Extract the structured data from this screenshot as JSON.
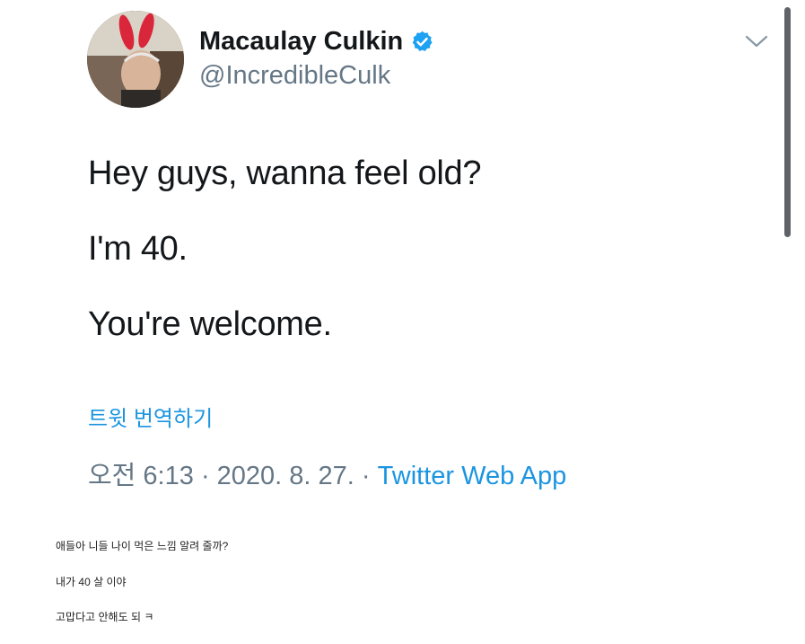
{
  "tweet": {
    "author_name": "Macaulay Culkin",
    "author_handle": "@IncredibleCulk",
    "lines": [
      "Hey guys, wanna feel old?",
      "I'm 40.",
      "You're welcome."
    ],
    "translate_label": "트윗 번역하기",
    "time": "오전 6:13",
    "separator": "·",
    "date": "2020. 8. 27.",
    "source": "Twitter Web App"
  },
  "captions": [
    "애들아 니들 나이 먹은 느낌 알려 줄까?",
    "내가 40 살 이야",
    "고맙다고 안해도 되 ㅋ"
  ],
  "colors": {
    "verified": "#1da1f2",
    "link": "#1b95e0",
    "secondary_text": "#657786"
  },
  "icons": {
    "verified": "verified-badge-icon",
    "more": "chevron-down-icon"
  }
}
